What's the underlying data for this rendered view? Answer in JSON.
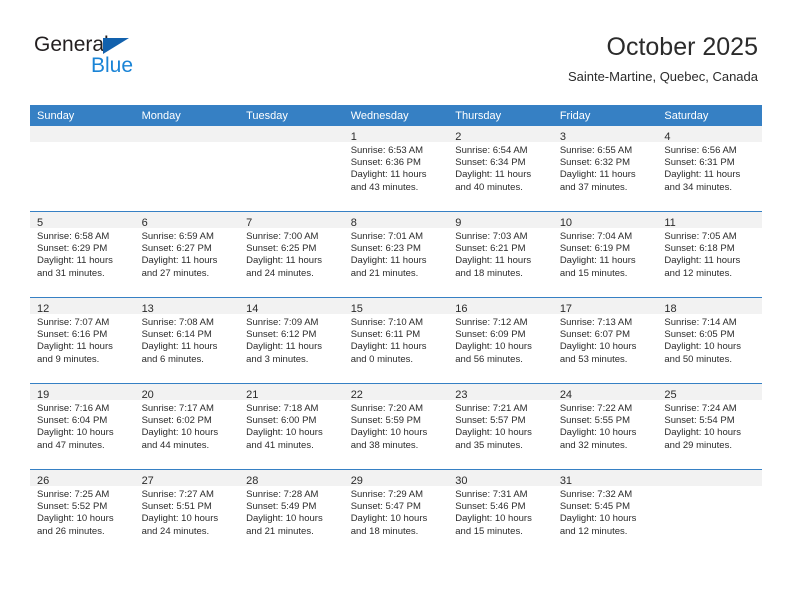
{
  "brand": {
    "word_one": "General",
    "word_two": "Blue",
    "flag_icon": "blue-triangle-flag-icon",
    "accent_dark": "#1261ad",
    "accent_light": "#1a84d6"
  },
  "header": {
    "title": "October 2025",
    "subtitle": "Sainte-Martine, Quebec, Canada"
  },
  "theme": {
    "header_bar": "#3680c4",
    "daynum_band": "#f2f2f2",
    "text": "#2b2b2b"
  },
  "labels": {
    "sunrise_prefix": "Sunrise:",
    "sunset_prefix": "Sunset:",
    "daylight_prefix": "Daylight:"
  },
  "weekdays": [
    "Sunday",
    "Monday",
    "Tuesday",
    "Wednesday",
    "Thursday",
    "Friday",
    "Saturday"
  ],
  "weeks": [
    [
      {
        "day": "",
        "sunrise": "",
        "sunset": "",
        "daylight_line1": "",
        "daylight_line2": ""
      },
      {
        "day": "",
        "sunrise": "",
        "sunset": "",
        "daylight_line1": "",
        "daylight_line2": ""
      },
      {
        "day": "",
        "sunrise": "",
        "sunset": "",
        "daylight_line1": "",
        "daylight_line2": ""
      },
      {
        "day": "1",
        "sunrise": "Sunrise: 6:53 AM",
        "sunset": "Sunset: 6:36 PM",
        "daylight_line1": "Daylight: 11 hours",
        "daylight_line2": "and 43 minutes."
      },
      {
        "day": "2",
        "sunrise": "Sunrise: 6:54 AM",
        "sunset": "Sunset: 6:34 PM",
        "daylight_line1": "Daylight: 11 hours",
        "daylight_line2": "and 40 minutes."
      },
      {
        "day": "3",
        "sunrise": "Sunrise: 6:55 AM",
        "sunset": "Sunset: 6:32 PM",
        "daylight_line1": "Daylight: 11 hours",
        "daylight_line2": "and 37 minutes."
      },
      {
        "day": "4",
        "sunrise": "Sunrise: 6:56 AM",
        "sunset": "Sunset: 6:31 PM",
        "daylight_line1": "Daylight: 11 hours",
        "daylight_line2": "and 34 minutes."
      }
    ],
    [
      {
        "day": "5",
        "sunrise": "Sunrise: 6:58 AM",
        "sunset": "Sunset: 6:29 PM",
        "daylight_line1": "Daylight: 11 hours",
        "daylight_line2": "and 31 minutes."
      },
      {
        "day": "6",
        "sunrise": "Sunrise: 6:59 AM",
        "sunset": "Sunset: 6:27 PM",
        "daylight_line1": "Daylight: 11 hours",
        "daylight_line2": "and 27 minutes."
      },
      {
        "day": "7",
        "sunrise": "Sunrise: 7:00 AM",
        "sunset": "Sunset: 6:25 PM",
        "daylight_line1": "Daylight: 11 hours",
        "daylight_line2": "and 24 minutes."
      },
      {
        "day": "8",
        "sunrise": "Sunrise: 7:01 AM",
        "sunset": "Sunset: 6:23 PM",
        "daylight_line1": "Daylight: 11 hours",
        "daylight_line2": "and 21 minutes."
      },
      {
        "day": "9",
        "sunrise": "Sunrise: 7:03 AM",
        "sunset": "Sunset: 6:21 PM",
        "daylight_line1": "Daylight: 11 hours",
        "daylight_line2": "and 18 minutes."
      },
      {
        "day": "10",
        "sunrise": "Sunrise: 7:04 AM",
        "sunset": "Sunset: 6:19 PM",
        "daylight_line1": "Daylight: 11 hours",
        "daylight_line2": "and 15 minutes."
      },
      {
        "day": "11",
        "sunrise": "Sunrise: 7:05 AM",
        "sunset": "Sunset: 6:18 PM",
        "daylight_line1": "Daylight: 11 hours",
        "daylight_line2": "and 12 minutes."
      }
    ],
    [
      {
        "day": "12",
        "sunrise": "Sunrise: 7:07 AM",
        "sunset": "Sunset: 6:16 PM",
        "daylight_line1": "Daylight: 11 hours",
        "daylight_line2": "and 9 minutes."
      },
      {
        "day": "13",
        "sunrise": "Sunrise: 7:08 AM",
        "sunset": "Sunset: 6:14 PM",
        "daylight_line1": "Daylight: 11 hours",
        "daylight_line2": "and 6 minutes."
      },
      {
        "day": "14",
        "sunrise": "Sunrise: 7:09 AM",
        "sunset": "Sunset: 6:12 PM",
        "daylight_line1": "Daylight: 11 hours",
        "daylight_line2": "and 3 minutes."
      },
      {
        "day": "15",
        "sunrise": "Sunrise: 7:10 AM",
        "sunset": "Sunset: 6:11 PM",
        "daylight_line1": "Daylight: 11 hours",
        "daylight_line2": "and 0 minutes."
      },
      {
        "day": "16",
        "sunrise": "Sunrise: 7:12 AM",
        "sunset": "Sunset: 6:09 PM",
        "daylight_line1": "Daylight: 10 hours",
        "daylight_line2": "and 56 minutes."
      },
      {
        "day": "17",
        "sunrise": "Sunrise: 7:13 AM",
        "sunset": "Sunset: 6:07 PM",
        "daylight_line1": "Daylight: 10 hours",
        "daylight_line2": "and 53 minutes."
      },
      {
        "day": "18",
        "sunrise": "Sunrise: 7:14 AM",
        "sunset": "Sunset: 6:05 PM",
        "daylight_line1": "Daylight: 10 hours",
        "daylight_line2": "and 50 minutes."
      }
    ],
    [
      {
        "day": "19",
        "sunrise": "Sunrise: 7:16 AM",
        "sunset": "Sunset: 6:04 PM",
        "daylight_line1": "Daylight: 10 hours",
        "daylight_line2": "and 47 minutes."
      },
      {
        "day": "20",
        "sunrise": "Sunrise: 7:17 AM",
        "sunset": "Sunset: 6:02 PM",
        "daylight_line1": "Daylight: 10 hours",
        "daylight_line2": "and 44 minutes."
      },
      {
        "day": "21",
        "sunrise": "Sunrise: 7:18 AM",
        "sunset": "Sunset: 6:00 PM",
        "daylight_line1": "Daylight: 10 hours",
        "daylight_line2": "and 41 minutes."
      },
      {
        "day": "22",
        "sunrise": "Sunrise: 7:20 AM",
        "sunset": "Sunset: 5:59 PM",
        "daylight_line1": "Daylight: 10 hours",
        "daylight_line2": "and 38 minutes."
      },
      {
        "day": "23",
        "sunrise": "Sunrise: 7:21 AM",
        "sunset": "Sunset: 5:57 PM",
        "daylight_line1": "Daylight: 10 hours",
        "daylight_line2": "and 35 minutes."
      },
      {
        "day": "24",
        "sunrise": "Sunrise: 7:22 AM",
        "sunset": "Sunset: 5:55 PM",
        "daylight_line1": "Daylight: 10 hours",
        "daylight_line2": "and 32 minutes."
      },
      {
        "day": "25",
        "sunrise": "Sunrise: 7:24 AM",
        "sunset": "Sunset: 5:54 PM",
        "daylight_line1": "Daylight: 10 hours",
        "daylight_line2": "and 29 minutes."
      }
    ],
    [
      {
        "day": "26",
        "sunrise": "Sunrise: 7:25 AM",
        "sunset": "Sunset: 5:52 PM",
        "daylight_line1": "Daylight: 10 hours",
        "daylight_line2": "and 26 minutes."
      },
      {
        "day": "27",
        "sunrise": "Sunrise: 7:27 AM",
        "sunset": "Sunset: 5:51 PM",
        "daylight_line1": "Daylight: 10 hours",
        "daylight_line2": "and 24 minutes."
      },
      {
        "day": "28",
        "sunrise": "Sunrise: 7:28 AM",
        "sunset": "Sunset: 5:49 PM",
        "daylight_line1": "Daylight: 10 hours",
        "daylight_line2": "and 21 minutes."
      },
      {
        "day": "29",
        "sunrise": "Sunrise: 7:29 AM",
        "sunset": "Sunset: 5:47 PM",
        "daylight_line1": "Daylight: 10 hours",
        "daylight_line2": "and 18 minutes."
      },
      {
        "day": "30",
        "sunrise": "Sunrise: 7:31 AM",
        "sunset": "Sunset: 5:46 PM",
        "daylight_line1": "Daylight: 10 hours",
        "daylight_line2": "and 15 minutes."
      },
      {
        "day": "31",
        "sunrise": "Sunrise: 7:32 AM",
        "sunset": "Sunset: 5:45 PM",
        "daylight_line1": "Daylight: 10 hours",
        "daylight_line2": "and 12 minutes."
      },
      {
        "day": "",
        "sunrise": "",
        "sunset": "",
        "daylight_line1": "",
        "daylight_line2": ""
      }
    ]
  ]
}
